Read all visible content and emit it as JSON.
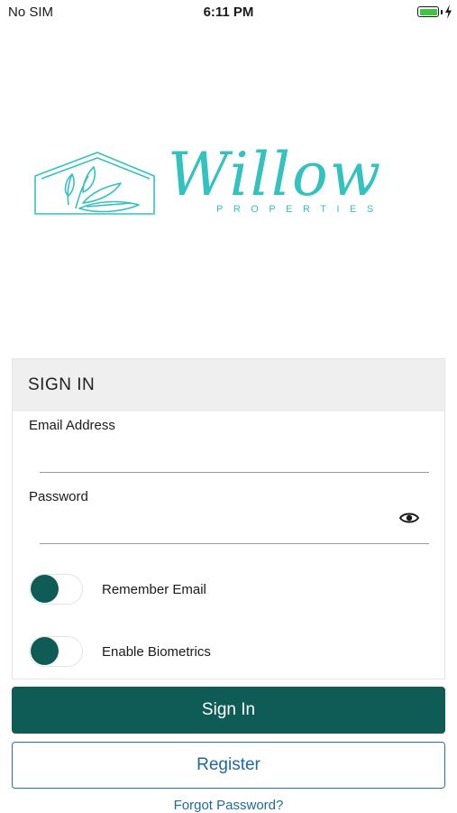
{
  "status_bar": {
    "carrier": "No SIM",
    "time": "6:11 PM",
    "battery_level": 1.0
  },
  "logo": {
    "name": "Willow",
    "subtitle": "PROPERTIES",
    "color": "#34c2c0"
  },
  "signin": {
    "header": "SIGN IN",
    "email_label": "Email Address",
    "email_value": "",
    "password_label": "Password",
    "password_value": "",
    "remember_label": "Remember Email",
    "remember_on": true,
    "biometrics_label": "Enable Biometrics",
    "biometrics_on": true,
    "show_password_icon": "eye-icon"
  },
  "actions": {
    "sign_in": "Sign In",
    "register": "Register",
    "forgot": "Forgot Password?"
  },
  "colors": {
    "primary": "#0f5c57",
    "link": "#1c6aa0",
    "header_bg": "#efefef"
  }
}
